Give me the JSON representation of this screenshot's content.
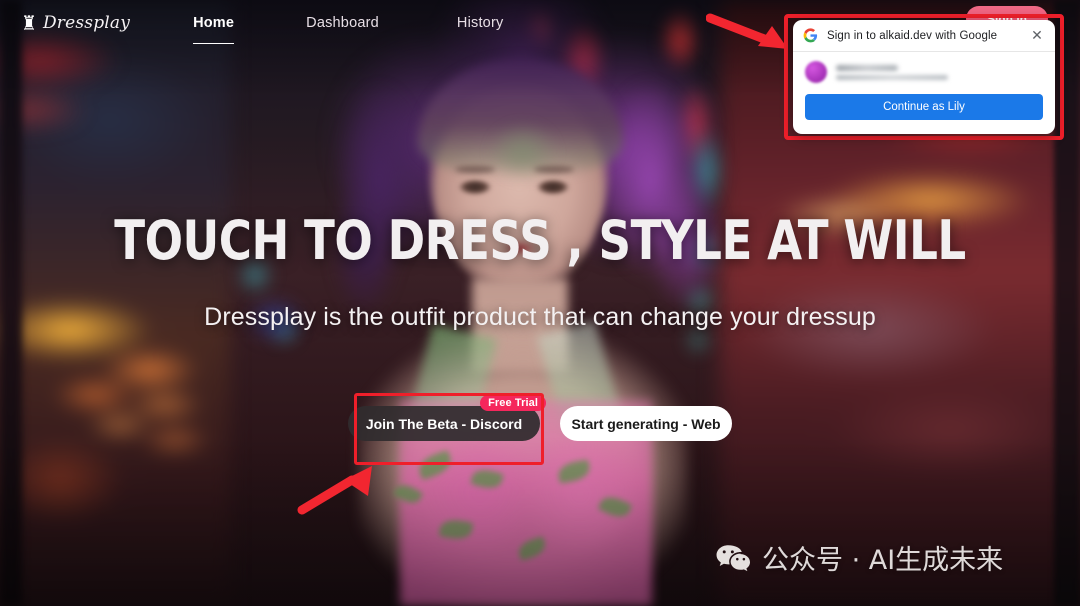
{
  "navbar": {
    "logo_text": "Dressplay",
    "logo_mark": "logo-mark-icon",
    "items": [
      {
        "label": "Home",
        "active": true
      },
      {
        "label": "Dashboard",
        "active": false
      },
      {
        "label": "History",
        "active": false
      }
    ],
    "signin_label": "Sign in"
  },
  "hero": {
    "headline": "TOUCH TO DRESS , STYLE AT WILL",
    "subhead": "Dressplay is the outfit product that can change your dressup",
    "cta_primary": "Join The Beta - Discord",
    "cta_primary_badge": "Free Trial",
    "cta_secondary": "Start generating - Web"
  },
  "google_popup": {
    "title": "Sign in to alkaid.dev with Google",
    "close_label": "✕",
    "account_name": "",
    "account_email": "",
    "continue_label": "Continue as Lily"
  },
  "watermark": {
    "text": "公众号 · AI生成未来",
    "icon": "wechat-icon"
  },
  "annotations": {
    "popup_box": "red-highlight-box",
    "cta_box": "red-highlight-box",
    "arrow_top": "red-arrow-pointing-right",
    "arrow_bottom": "red-arrow-pointing-up-right"
  },
  "colors": {
    "annotation_red": "#ef1f2a",
    "badge_red": "#f5275c",
    "google_blue": "#1b79e8",
    "signin_pink": "#e84d6e"
  }
}
